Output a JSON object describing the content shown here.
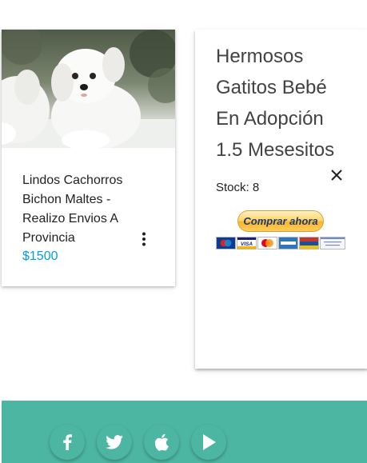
{
  "product": {
    "title": "Lindos Cachorros Bichon Maltes - Realizo Envios A Provincia",
    "price": "$1500",
    "image_icon": "puppy-photo"
  },
  "reveal": {
    "title": "Hermosos Gatitos Bebé En Adopción 1.5 Mesesitos",
    "stock": "Stock: 8",
    "close_icon": "close-icon",
    "paypal_label": "Comprar ahora",
    "card_logos": [
      "Maestro",
      "VISA",
      "MasterCard",
      "Amex",
      "Diners",
      "Cuenta bancaria"
    ]
  },
  "footer": {
    "social": [
      {
        "icon": "facebook-icon"
      },
      {
        "icon": "twitter-icon"
      },
      {
        "icon": "apple-icon"
      },
      {
        "icon": "play-icon"
      }
    ]
  },
  "colors": {
    "footer": "#4db6a2",
    "price": "#039be5",
    "paypal_text": "#1b3873"
  }
}
